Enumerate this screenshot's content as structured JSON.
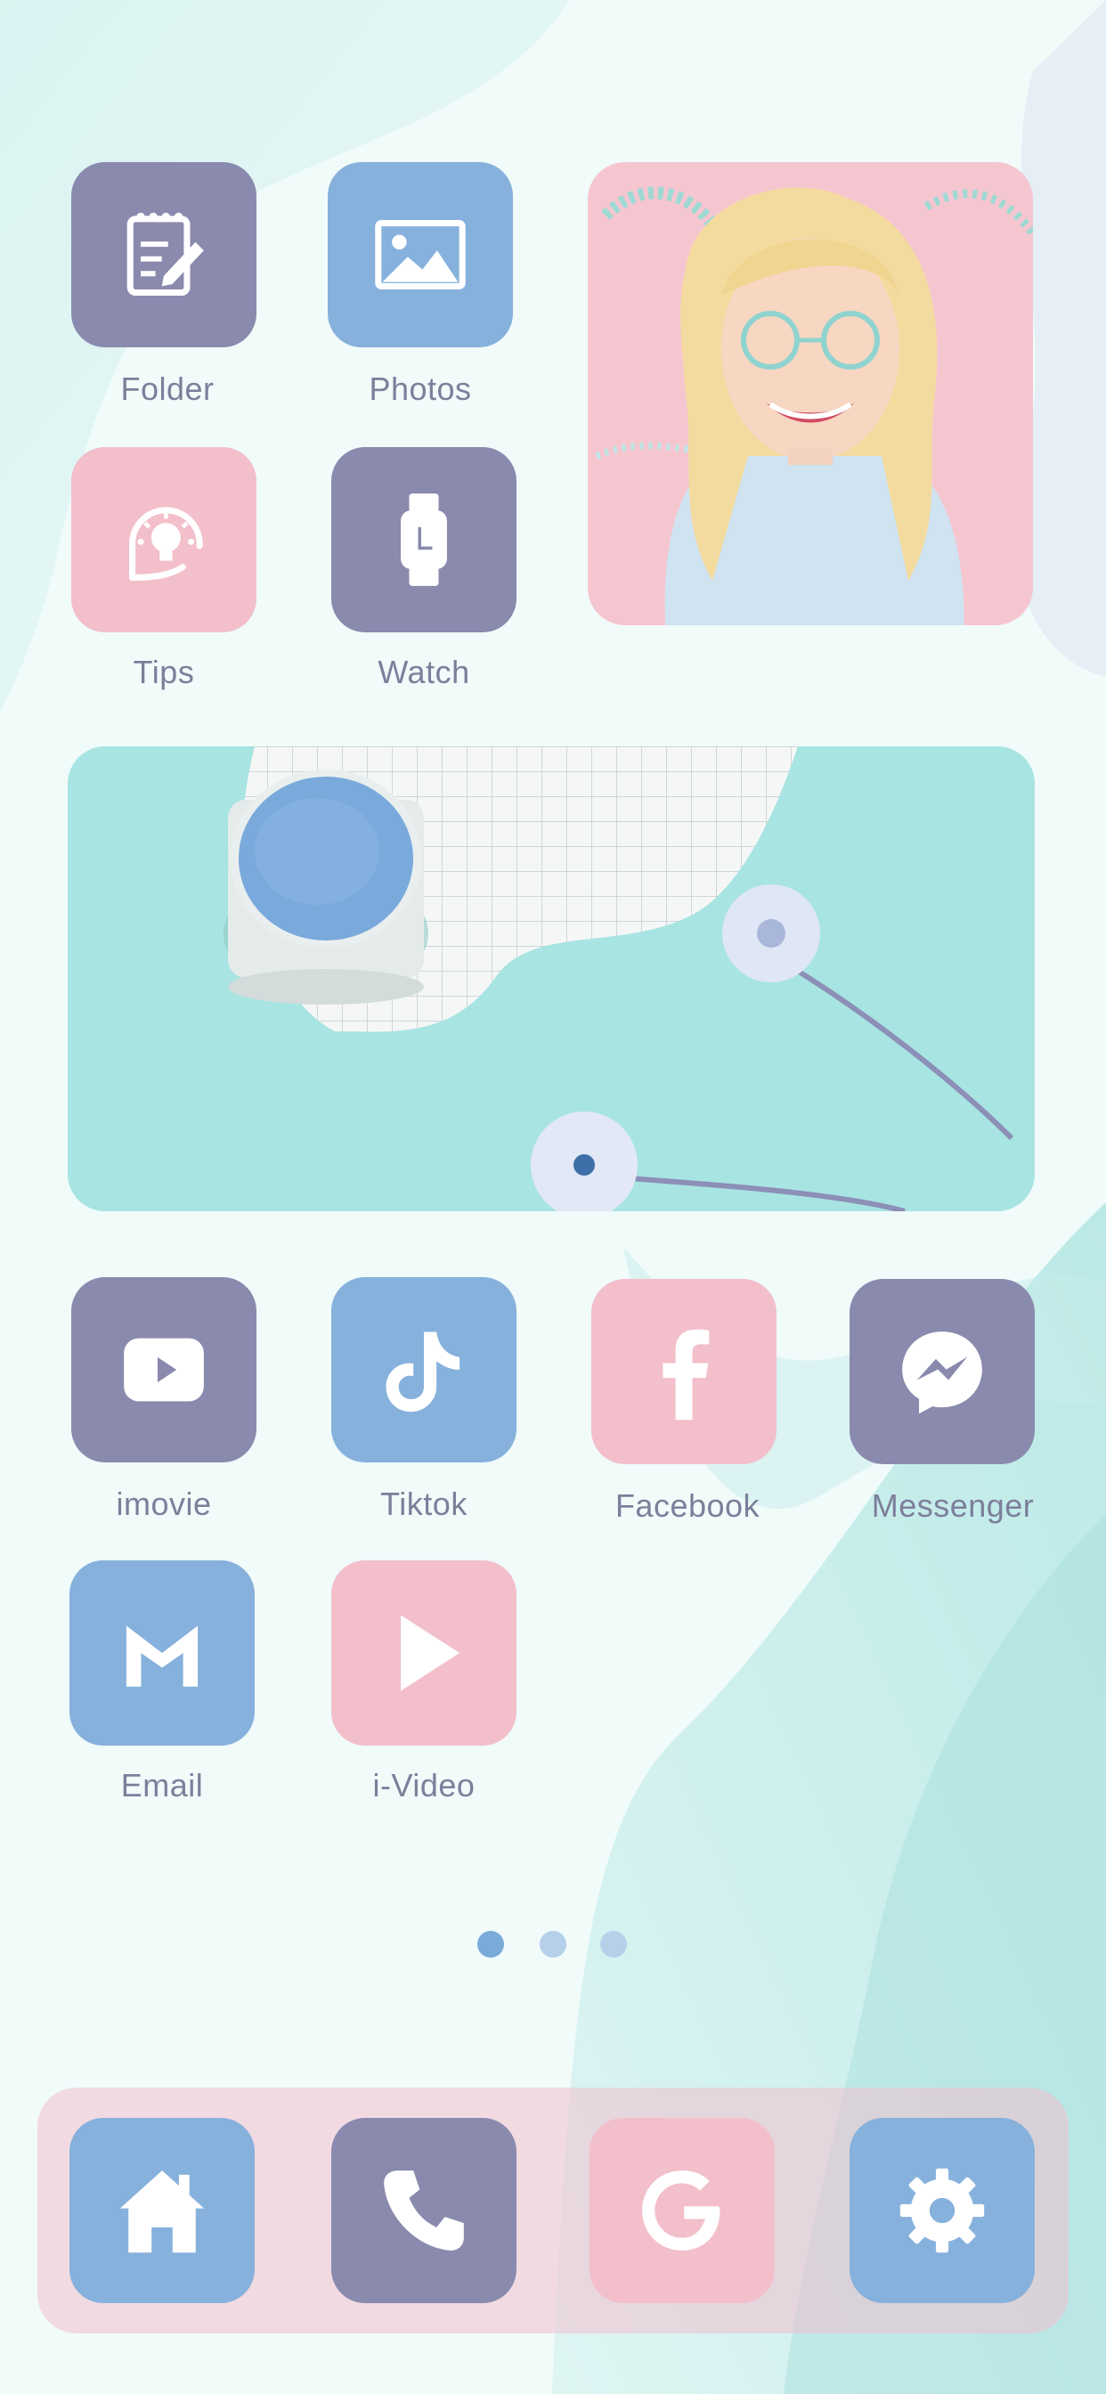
{
  "colors": {
    "purple": "#8a8aae",
    "blue": "#86b1dc",
    "pink": "#f2bfcb",
    "label": "#7d7f9a",
    "dot_active": "#7aaad8",
    "dot_inactive": "#b6d0ea"
  },
  "apps": {
    "folder": {
      "label": "Folder",
      "icon": "notepad-icon"
    },
    "photos": {
      "label": "Photos",
      "icon": "image-icon"
    },
    "tips": {
      "label": "Tips",
      "icon": "lightbulb-icon"
    },
    "watch": {
      "label": "Watch",
      "icon": "watch-icon"
    },
    "imovie": {
      "label": "imovie",
      "icon": "play-box-icon"
    },
    "tiktok": {
      "label": "Tiktok",
      "icon": "tiktok-icon"
    },
    "facebook": {
      "label": "Facebook",
      "icon": "facebook-icon"
    },
    "messenger": {
      "label": "Messenger",
      "icon": "messenger-icon"
    },
    "email": {
      "label": "Email",
      "icon": "mail-m-icon"
    },
    "ivideo": {
      "label": "i-Video",
      "icon": "play-triangle-icon"
    }
  },
  "dock": [
    {
      "name": "home",
      "icon": "house-icon"
    },
    {
      "name": "phone",
      "icon": "phone-icon"
    },
    {
      "name": "google",
      "icon": "google-g-icon"
    },
    {
      "name": "settings",
      "icon": "gear-icon"
    }
  ],
  "page_indicator": {
    "count": 3,
    "active": 1
  }
}
